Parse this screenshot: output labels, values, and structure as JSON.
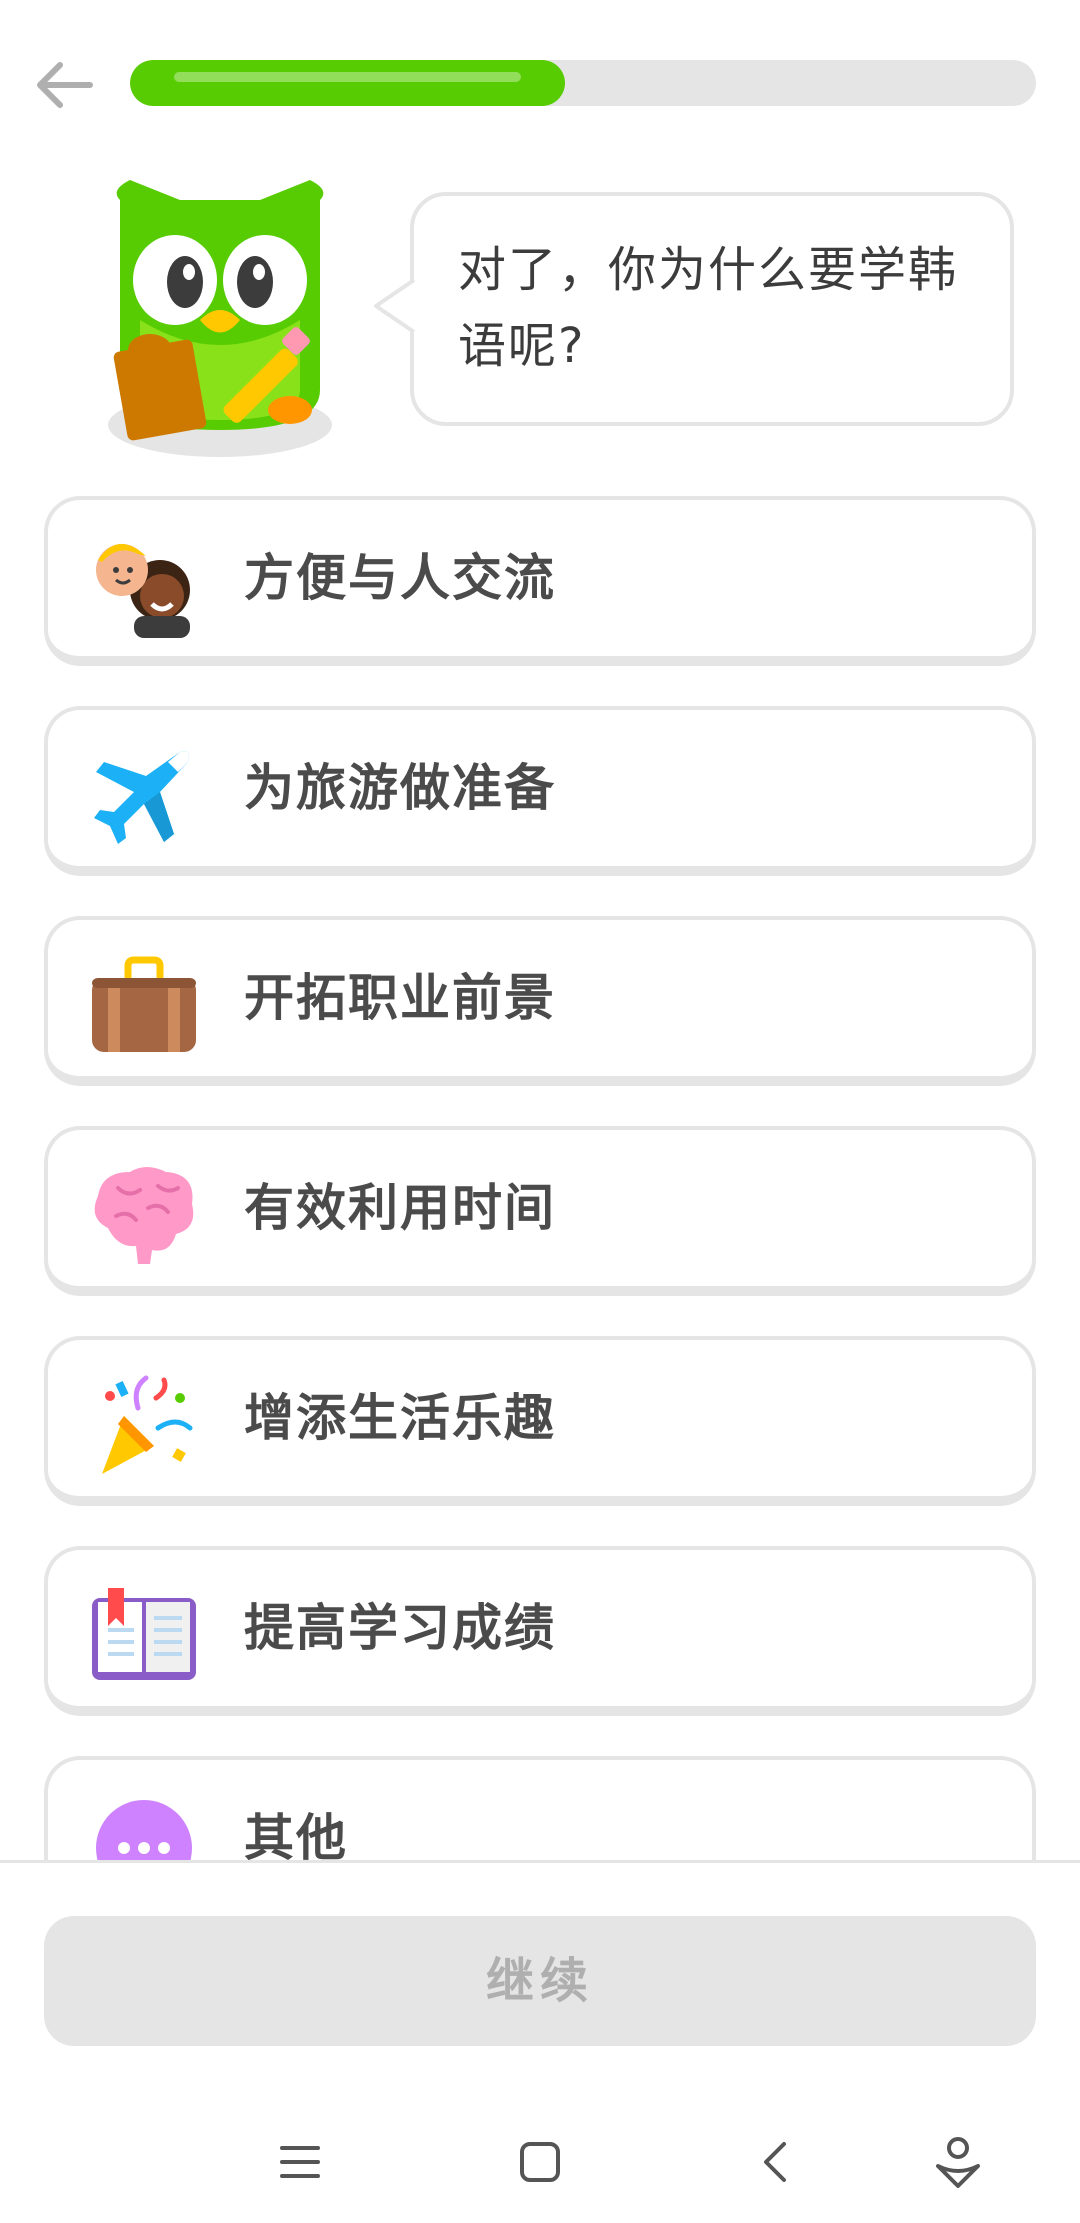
{
  "header": {
    "back_icon": "arrow-left-icon",
    "progress_percent": 48,
    "progress_color": "#58cc02"
  },
  "prompt": {
    "mascot_icon": "owl-mascot-icon",
    "question": "对了，你为什么要学韩语呢?"
  },
  "options": [
    {
      "label": "方便与人交流",
      "icon": "people-icon"
    },
    {
      "label": "为旅游做准备",
      "icon": "airplane-icon"
    },
    {
      "label": "开拓职业前景",
      "icon": "briefcase-icon"
    },
    {
      "label": "有效利用时间",
      "icon": "brain-icon"
    },
    {
      "label": "增添生活乐趣",
      "icon": "party-popper-icon"
    },
    {
      "label": "提高学习成绩",
      "icon": "book-icon"
    },
    {
      "label": "其他",
      "icon": "more-dots-icon"
    }
  ],
  "footer": {
    "continue_label": "继续"
  },
  "navbar": {
    "items": [
      "menu-icon",
      "home-square-icon",
      "back-chevron-icon",
      "assistant-icon"
    ]
  }
}
